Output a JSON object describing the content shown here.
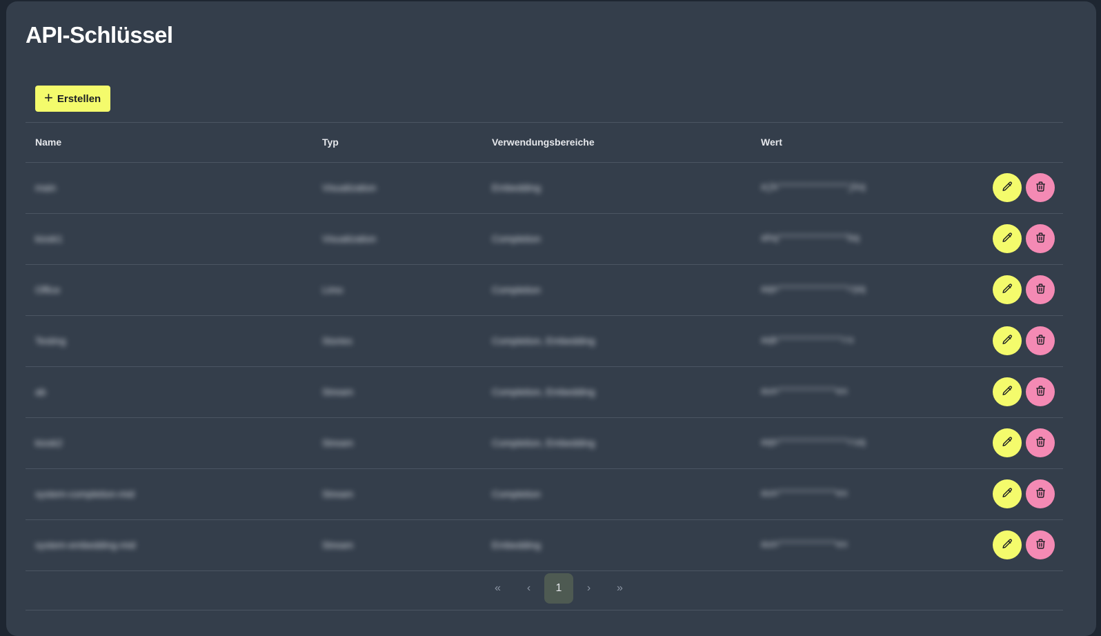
{
  "page": {
    "title": "API-Schlüssel",
    "create_label": "Erstellen"
  },
  "table": {
    "headers": {
      "name": "Name",
      "typ": "Typ",
      "scopes": "Verwendungsbereiche",
      "wert": "Wert"
    },
    "rows": [
      {
        "name": "main",
        "typ": "Visualization",
        "scopes": "Embedding",
        "wert": "ajk************jkq"
      },
      {
        "name": "kiosk1",
        "typ": "Visualization",
        "scopes": "Completion",
        "wert": "ahq************bq"
      },
      {
        "name": "Office",
        "typ": "Limo",
        "scopes": "Completion",
        "wert": "aqn************rpq"
      },
      {
        "name": "Testing",
        "typ": "Stories",
        "scopes": "Completion, Embedding",
        "wert": "aqk***********ro"
      },
      {
        "name": "ab",
        "typ": "Stream",
        "scopes": "Completion, Embedding",
        "wert": "aun**********ex"
      },
      {
        "name": "kiosk2",
        "typ": "Stream",
        "scopes": "Completion, Embedding",
        "wert": "aqn************ruq"
      },
      {
        "name": "system-completion-mid",
        "typ": "Stream",
        "scopes": "Completion",
        "wert": "aun**********ex"
      },
      {
        "name": "system-embedding-mid",
        "typ": "Stream",
        "scopes": "Embedding",
        "wert": "aun**********ex"
      }
    ]
  },
  "pagination": {
    "first": "«",
    "prev": "‹",
    "current": "1",
    "next": "›",
    "last": "»"
  },
  "colors": {
    "background": "#343e4b",
    "accent_yellow": "#f4fb6c",
    "accent_pink": "#f48ab4"
  }
}
